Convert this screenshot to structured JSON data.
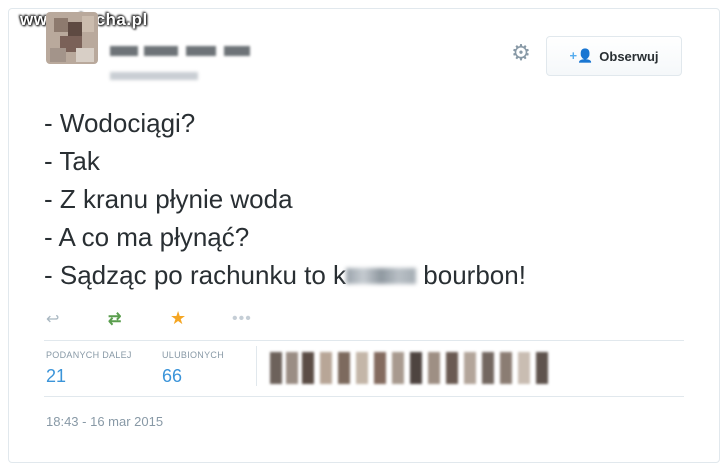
{
  "watermark": "www.wiocha.pl",
  "header": {
    "follow_label": "Obserwuj",
    "gear_icon": "gear-icon",
    "follow_icon": "add-user-icon"
  },
  "tweet": {
    "lines": [
      "- Wodociągi?",
      "- Tak",
      "- Z kranu płynie woda",
      "- A co ma płynąć?"
    ],
    "last_line_prefix": "- Sądząc po rachunku to k",
    "last_line_suffix": " bourbon!"
  },
  "actions": {
    "reply_icon": "reply-icon",
    "retweet_icon": "retweet-icon",
    "favorite_icon": "star-icon",
    "more_icon": "more-icon"
  },
  "stats": {
    "retweets_label": "PODANYCH DALEJ",
    "retweets_value": "21",
    "favorites_label": "ULUBIONYCH",
    "favorites_value": "66"
  },
  "timestamp": "18:43 - 16 mar 2015",
  "colors": {
    "link_blue": "#3b94d9",
    "retweet_green": "#5a9e4e",
    "favorite_gold": "#f5a623",
    "muted_gray": "#8899a6"
  }
}
